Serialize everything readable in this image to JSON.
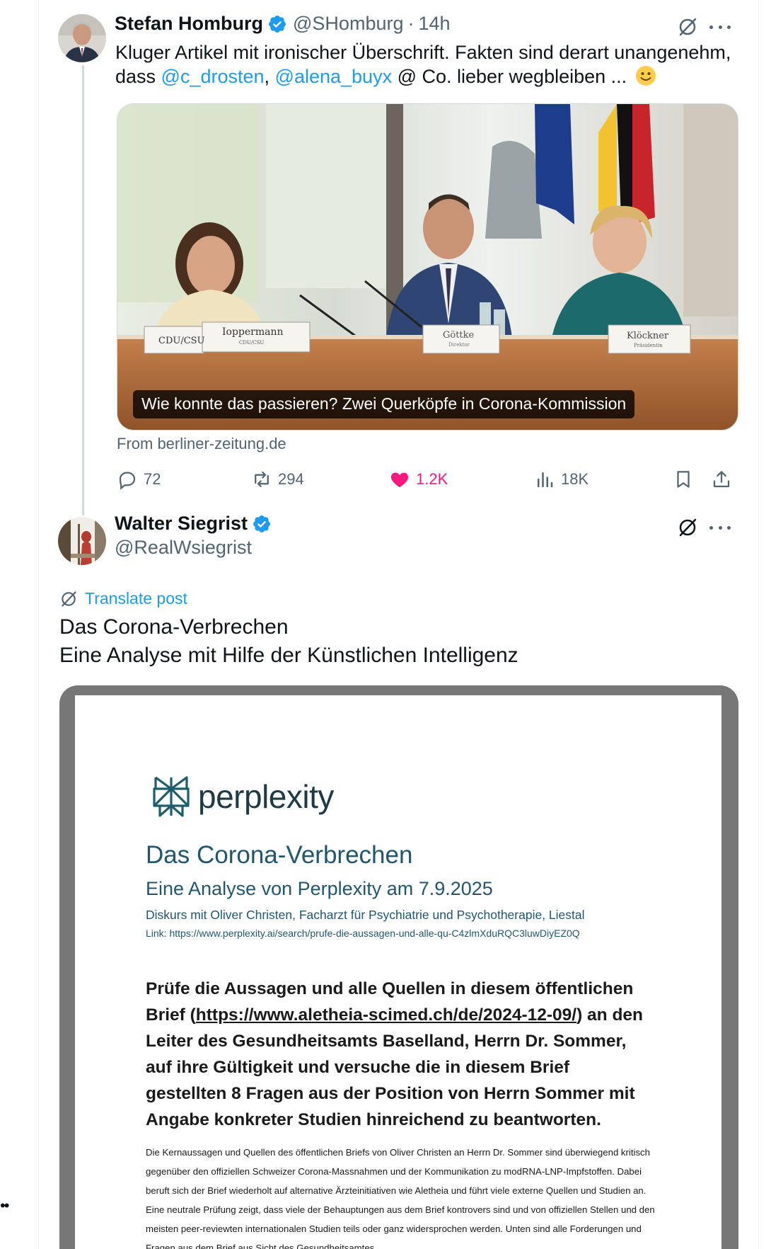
{
  "tweet1": {
    "author_name": "Stefan Homburg",
    "handle": "@SHomburg",
    "time": "14h",
    "text_line1": "Kluger Artikel mit ironischer Überschrift. Fakten sind derart unangenehm,",
    "text_prefix": "dass ",
    "mention1": "@c_drosten",
    "comma": ", ",
    "mention2": "@alena_buyx",
    "text_suffix": " @ Co. lieber wegbleiben ...",
    "card": {
      "headline": "Wie konnte das passieren? Zwei Querköpfe in Corona-Kommission",
      "source": "From berliner-zeitung.de",
      "placards": [
        "CDU/CSU",
        "Ioppermann",
        "CDU/CSU",
        "Göttke",
        "Direktor",
        "Klöckner",
        "Präsidentin"
      ]
    },
    "stats": {
      "replies": "72",
      "reposts": "294",
      "likes": "1.2K",
      "views": "18K"
    }
  },
  "tweet2": {
    "author_name": "Walter Siegrist",
    "handle": "@RealWsiegrist",
    "translate_label": "Translate post",
    "text_line1": "Das Corona-Verbrechen",
    "text_line2": "Eine Analyse mit Hilfe der Künstlichen Intelligenz",
    "document": {
      "logo_text": "perplexity",
      "title": "Das Corona-Verbrechen",
      "subtitle": "Eine Analyse von Perplexity am 7.9.2025",
      "discourse": "Diskurs mit Oliver Christen, Facharzt für Psychiatrie und Psychotherapie, Liestal",
      "link": "Link: https://www.perplexity.ai/search/prufe-die-aussagen-und-alle-qu-C4zlmXduRQC3luwDiyEZ0Q",
      "prompt_before": "Prüfe die Aussagen und alle Quellen in diesem öffentlichen Brief (",
      "prompt_url": "https://www.aletheia-scimed.ch/de/2024-12-09/",
      "prompt_after": ") an den Leiter des Gesundheitsamts Baselland, Herrn Dr. Sommer, auf ihre Gültigkeit und versuche die in diesem Brief gestellten 8 Fragen aus der Position von Herrn Sommer mit Angabe konkreter Studien hinreichend zu beantworten.",
      "body": "Die Kernaussagen und Quellen des öffentlichen Briefs von Oliver Christen an Herrn Dr. Sommer sind überwiegend kritisch gegenüber den offiziellen Schweizer Corona-Massnahmen und der Kommunikation zu modRNA-LNP-Impfstoffen. Dabei beruft sich der Brief wiederholt auf alternative Ärzteinitiativen wie Aletheia und führt viele externe Quellen und Studien an. Eine neutrale Prüfung zeigt, dass viele der Behauptungen aus dem Brief kontrovers sind und von offiziellen Stellen und den meisten peer-reviewten internationalen Studien teils oder ganz widersprochen werden. Unten sind alle Forderungen und Fragen aus dem Brief aus Sicht des Gesundheitsamtes,"
    }
  },
  "colors": {
    "accent": "#1d9bf0",
    "like": "#f91880",
    "secondary_text": "#536471",
    "doc_heading": "#21566d"
  },
  "edge_marker": "••"
}
